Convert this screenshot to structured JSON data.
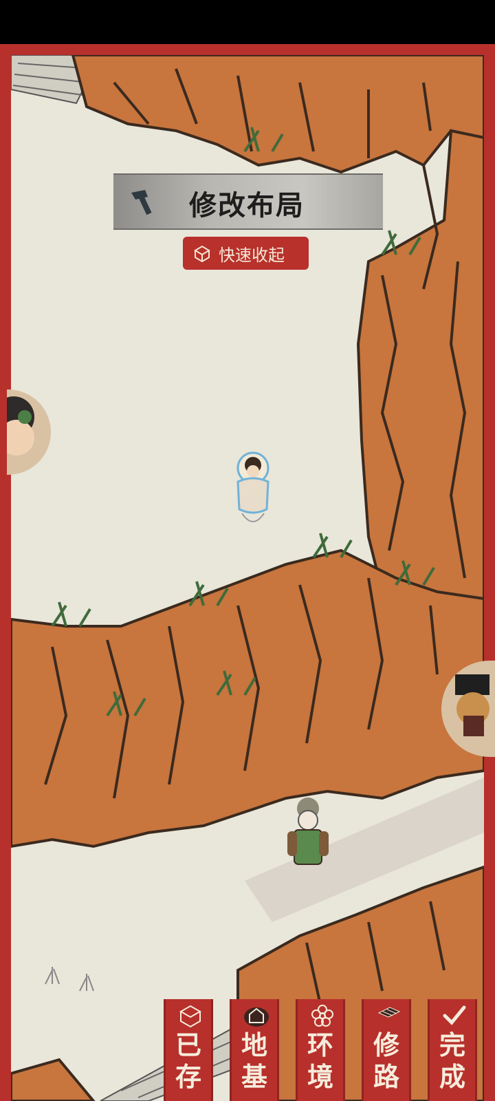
{
  "header": {
    "title": "修改布局",
    "hammer_icon": "hammer-icon"
  },
  "quick_collapse": {
    "label": "快速收起",
    "icon": "box-collapse-icon"
  },
  "tabs": [
    {
      "key": "saved",
      "label_top": "已",
      "label_bottom": "存",
      "icon": "box-icon"
    },
    {
      "key": "foundation",
      "label_top": "地",
      "label_bottom": "基",
      "icon": "house-foundation-icon"
    },
    {
      "key": "environment",
      "label_top": "环",
      "label_bottom": "境",
      "icon": "flower-icon"
    },
    {
      "key": "road",
      "label_top": "修",
      "label_bottom": "路",
      "icon": "road-tile-icon"
    },
    {
      "key": "done",
      "label_top": "完",
      "label_bottom": "成",
      "icon": "checkmark-icon"
    }
  ],
  "colors": {
    "frame": "#b7302b",
    "ground": "#e9e6da",
    "rock": "#c8753e",
    "banner": "#b8b6b1"
  }
}
